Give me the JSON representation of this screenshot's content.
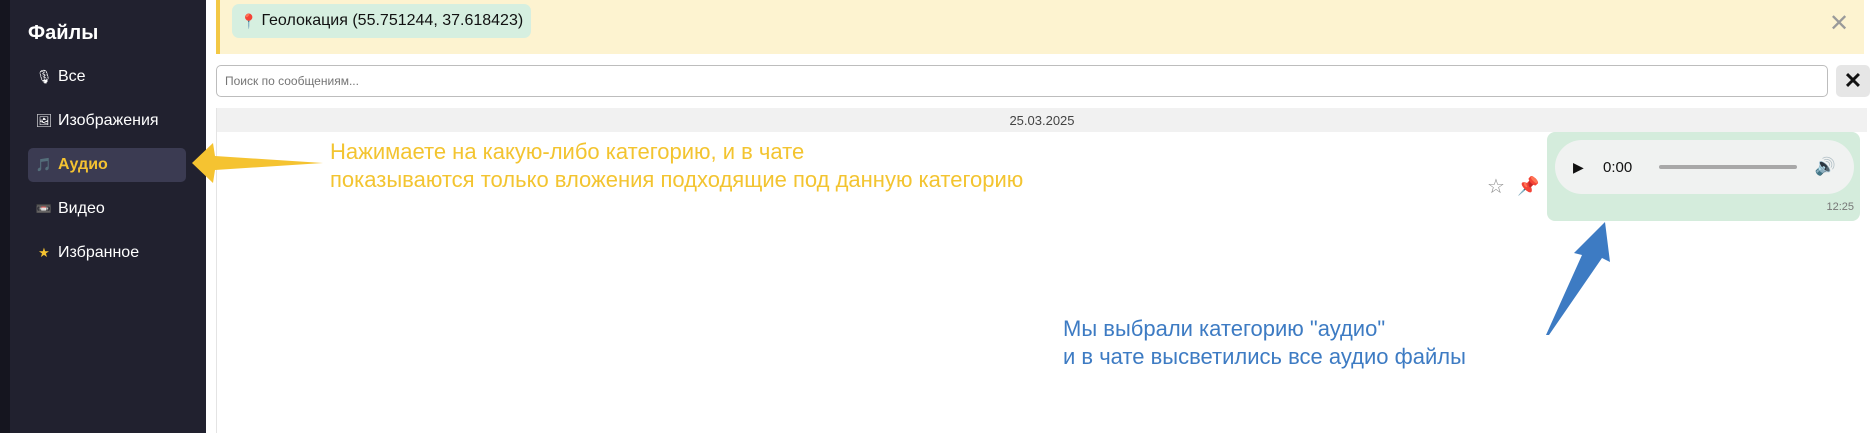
{
  "sidebar": {
    "title": "Файлы",
    "items": [
      {
        "label": "Все",
        "icon": "microphone-icon",
        "glyph": "🎙"
      },
      {
        "label": "Изображения",
        "icon": "image-icon",
        "glyph": "🖼"
      },
      {
        "label": "Аудио",
        "icon": "music-icon",
        "glyph": "🎵",
        "active": true
      },
      {
        "label": "Видео",
        "icon": "video-icon",
        "glyph": "📼"
      },
      {
        "label": "Избранное",
        "icon": "star-icon",
        "glyph": "★"
      }
    ]
  },
  "banner": {
    "text": "Геолокация (55.751244, 37.618423)",
    "close": "✕"
  },
  "search": {
    "placeholder": "Поиск по сообщениям...",
    "clear": "✕"
  },
  "chat": {
    "date": "25.03.2025",
    "message": {
      "audio_time": "0:00",
      "timestamp": "12:25"
    }
  },
  "annotations": {
    "yellow_line1": "Нажимаете на какую-либо категорию, и в чате",
    "yellow_line2": "показываются только вложения подходящие под данную категорию",
    "blue_line1": "Мы выбрали категорию \"аудио\"",
    "blue_line2": "и в чате высветились все аудио файлы"
  },
  "colors": {
    "sidebar_bg": "#21212f",
    "accent_active": "#f5c331",
    "banner_bg": "#fdf3d0",
    "bubble_bg": "#d4ecdc",
    "annotation_yellow": "#f3c430",
    "annotation_blue": "#3d7bc3"
  }
}
